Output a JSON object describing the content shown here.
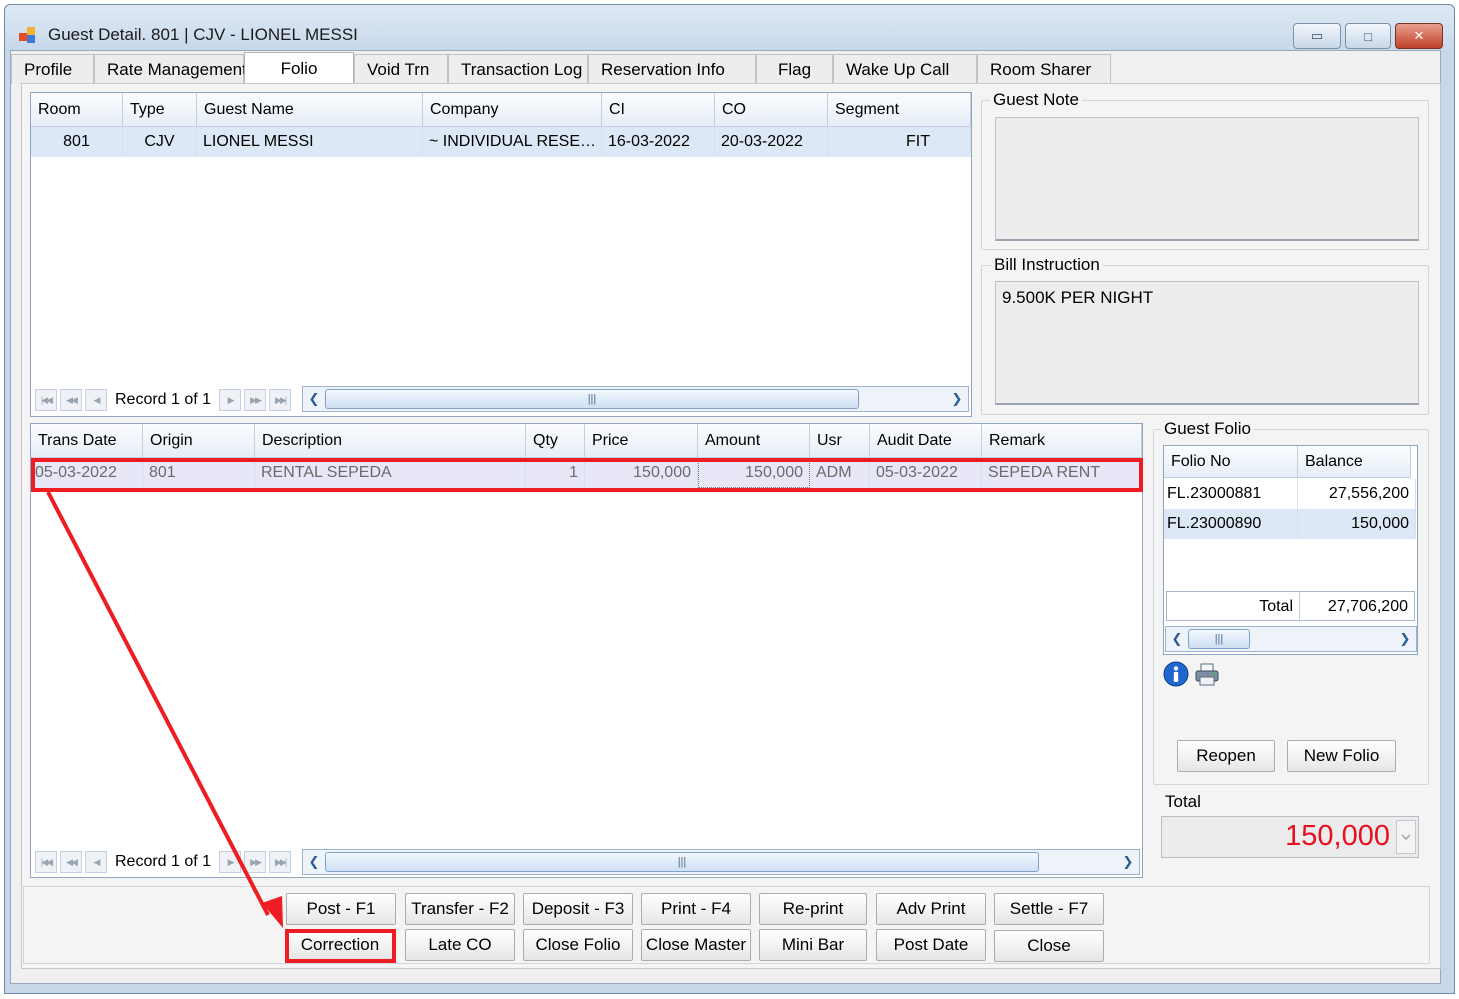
{
  "window": {
    "title": "Guest Detail. 801 | CJV - LIONEL MESSI",
    "minimize_glyph": "▭",
    "maximize_glyph": "□",
    "close_glyph": "✕"
  },
  "tabs": [
    {
      "label": "Profile"
    },
    {
      "label": "Rate Management"
    },
    {
      "label": "Folio"
    },
    {
      "label": "Void Trn"
    },
    {
      "label": "Transaction Log"
    },
    {
      "label": "Reservation Info"
    },
    {
      "label": "Flag"
    },
    {
      "label": "Wake Up Call"
    },
    {
      "label": "Room Sharer"
    }
  ],
  "guest_grid": {
    "columns": [
      "Room",
      "Type",
      "Guest Name",
      "Company",
      "CI",
      "CO",
      "Segment"
    ],
    "rows": [
      {
        "room": "801",
        "type": "CJV",
        "guest_name": "LIONEL MESSI",
        "company": "~ INDIVIDUAL RESE…",
        "ci": "16-03-2022",
        "co": "20-03-2022",
        "segment": "FIT"
      }
    ],
    "record_text": "Record 1 of 1"
  },
  "transaction_grid": {
    "columns": [
      "Trans Date",
      "Origin",
      "Description",
      "Qty",
      "Price",
      "Amount",
      "Usr",
      "Audit Date",
      "Remark"
    ],
    "rows": [
      {
        "trans_date": "05-03-2022",
        "origin": "801",
        "description": "RENTAL SEPEDA",
        "qty": "1",
        "price": "150,000",
        "amount": "150,000",
        "usr": "ADM",
        "audit_date": "05-03-2022",
        "remark": "SEPEDA RENT"
      }
    ],
    "record_text": "Record 1 of 1"
  },
  "guest_note": {
    "label": "Guest Note",
    "value": ""
  },
  "bill_instruction": {
    "label": "Bill Instruction",
    "value": "9.500K PER NIGHT"
  },
  "guest_folio": {
    "label": "Guest Folio",
    "columns": [
      "Folio No",
      "Balance"
    ],
    "rows": [
      {
        "folio_no": "FL.23000881",
        "balance": "27,556,200"
      },
      {
        "folio_no": "FL.23000890",
        "balance": "150,000"
      }
    ],
    "total_label": "Total",
    "total_value": "27,706,200",
    "reopen_label": "Reopen",
    "new_folio_label": "New Folio"
  },
  "total": {
    "label": "Total",
    "value": "150,000",
    "value_color": "#e8101e"
  },
  "actions": {
    "row1": [
      "Post - F1",
      "Transfer - F2",
      "Deposit - F3",
      "Print - F4",
      "Re-print",
      "Adv Print",
      "Settle - F7"
    ],
    "row2": [
      "Correction",
      "Late CO",
      "Close Folio",
      "Close Master",
      "Mini Bar",
      "Post Date",
      "Close"
    ]
  },
  "nav_glyphs": {
    "first": "|◀◀",
    "prev_page": "◀◀",
    "prev": "◀",
    "next": "▶",
    "next_page": "▶▶",
    "last": "▶▶|"
  },
  "scroll_glyphs": {
    "left": "❮",
    "right": "❯",
    "grip": "|||"
  },
  "colors": {
    "highlight": "#ee1c23",
    "selected_row": "#dde8f6",
    "accent": "#2b5b93"
  }
}
